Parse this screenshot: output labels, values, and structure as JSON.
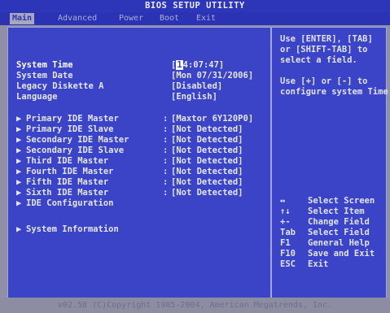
{
  "title": "BIOS SETUP UTILITY",
  "tabs": [
    {
      "label": "Main"
    },
    {
      "label": "Advanced"
    },
    {
      "label": "Power"
    },
    {
      "label": "Boot"
    },
    {
      "label": "Exit"
    }
  ],
  "settings": {
    "system_time": {
      "label": "System Time",
      "cursor_digit": "1",
      "value_rest": "4:07:47]",
      "value_open": "["
    },
    "system_date": {
      "label": "System Date",
      "value": "[Mon 07/31/2006]"
    },
    "legacy_diskette": {
      "label": "Legacy Diskette A",
      "value": "[Disabled]"
    },
    "language": {
      "label": "Language",
      "value": "[English]"
    }
  },
  "ide_items": [
    {
      "arrow": "▶",
      "label": "Primary IDE Master",
      "sep": ":",
      "value": "[Maxtor 6Y120P0]"
    },
    {
      "arrow": "▶",
      "label": "Primary IDE Slave",
      "sep": ":",
      "value": "[Not Detected]"
    },
    {
      "arrow": "▶",
      "label": "Secondary IDE Master",
      "sep": ":",
      "value": "[Not Detected]"
    },
    {
      "arrow": "▶",
      "label": "Secondary IDE Slave",
      "sep": ":",
      "value": "[Not Detected]"
    },
    {
      "arrow": "▶",
      "label": "Third IDE Master",
      "sep": ":",
      "value": "[Not Detected]"
    },
    {
      "arrow": "▶",
      "label": "Fourth IDE Master",
      "sep": ":",
      "value": "[Not Detected]"
    },
    {
      "arrow": "▶",
      "label": "Fifth IDE Master",
      "sep": ":",
      "value": "[Not Detected]"
    },
    {
      "arrow": "▶",
      "label": "Sixth IDE Master",
      "sep": ":",
      "value": "[Not Detected]"
    }
  ],
  "ide_configuration": {
    "arrow": "▶",
    "label": "IDE Configuration"
  },
  "system_information": {
    "arrow": "▶",
    "label": "System Information"
  },
  "help": {
    "line1": "Use [ENTER], [TAB]",
    "line2": "or [SHIFT-TAB] to",
    "line3": "select a field.",
    "line4": "Use [+] or [-] to",
    "line5": "configure system Time."
  },
  "keys": [
    {
      "key": "↔",
      "desc": "Select Screen"
    },
    {
      "key": "↑↓",
      "desc": "Select Item"
    },
    {
      "key": "+-",
      "desc": "Change Field"
    },
    {
      "key": "Tab",
      "desc": "Select Field"
    },
    {
      "key": "F1",
      "desc": "General Help"
    },
    {
      "key": "F10",
      "desc": "Save and Exit"
    },
    {
      "key": "ESC",
      "desc": "Exit"
    }
  ],
  "footer": "v02.58 (C)Copyright 1985-2004, American Megatrends, Inc.",
  "colors": {
    "panel_bg": "#3b44c6",
    "title_bg": "#2d35b8",
    "border": "#a3a7d9"
  }
}
